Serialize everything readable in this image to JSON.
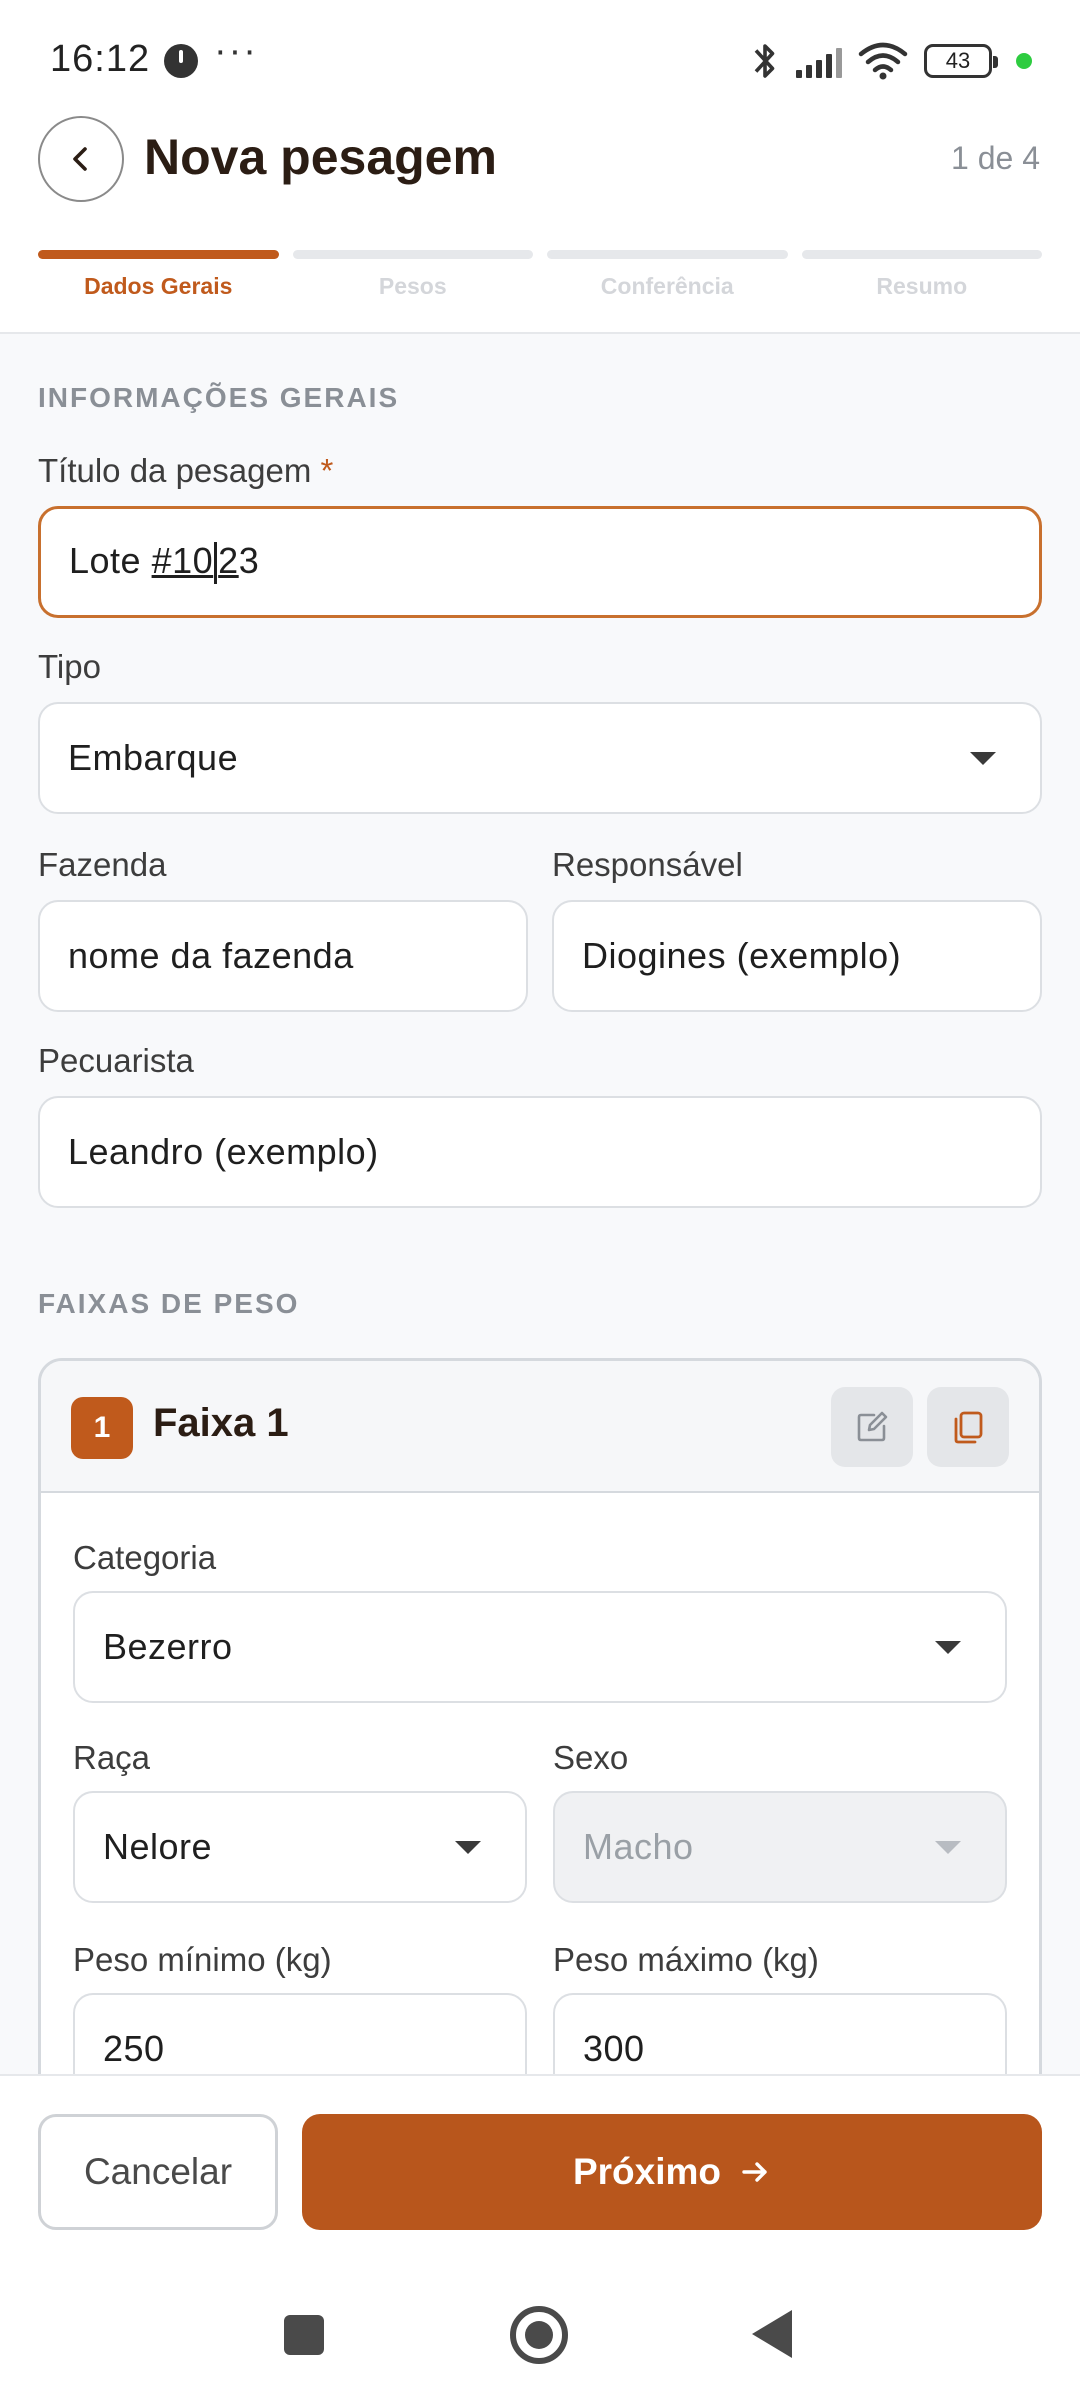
{
  "status_bar": {
    "time": "16:12",
    "dots": "···",
    "battery": "43",
    "icons": [
      "clock-icon",
      "bluetooth-icon",
      "signal-icon",
      "wifi-icon",
      "battery-icon",
      "dot-icon"
    ]
  },
  "header": {
    "title": "Nova pesagem",
    "step_count": "1 de 4",
    "steps": [
      {
        "label": "Dados Gerais",
        "active": true
      },
      {
        "label": "Pesos",
        "active": false
      },
      {
        "label": "Conferência",
        "active": false
      },
      {
        "label": "Resumo",
        "active": false
      }
    ]
  },
  "general": {
    "section_title": "INFORMAÇÕES GERAIS",
    "title_label": "Título da pesagem",
    "required_mark": "*",
    "title_value_a": "Lote ",
    "title_value_u1": "#10",
    "title_value_u2": "2",
    "title_value_b": "3",
    "tipo_label": "Tipo",
    "tipo_value": "Embarque",
    "fazenda_label": "Fazenda",
    "fazenda_value": "nome da fazenda",
    "responsavel_label": "Responsável",
    "responsavel_value": "Diogines (exemplo)",
    "pecuarista_label": "Pecuarista",
    "pecuarista_value": "Leandro (exemplo)"
  },
  "ranges": {
    "section_title": "FAIXAS DE PESO",
    "card": {
      "badge": "1",
      "title": "Faixa 1",
      "categoria_label": "Categoria",
      "categoria_value": "Bezerro",
      "raca_label": "Raça",
      "raca_value": "Nelore",
      "sexo_label": "Sexo",
      "sexo_value": "Macho",
      "peso_min_label": "Peso mínimo (kg)",
      "peso_min_value": "250",
      "peso_max_label": "Peso máximo (kg)",
      "peso_max_value": "300"
    }
  },
  "footer": {
    "cancel_label": "Cancelar",
    "next_label": "Próximo"
  },
  "colors": {
    "accent": "#c05a1c",
    "primary_button": "#b8561c",
    "focus_border": "#c8702e",
    "muted_text": "#8a8f96"
  }
}
